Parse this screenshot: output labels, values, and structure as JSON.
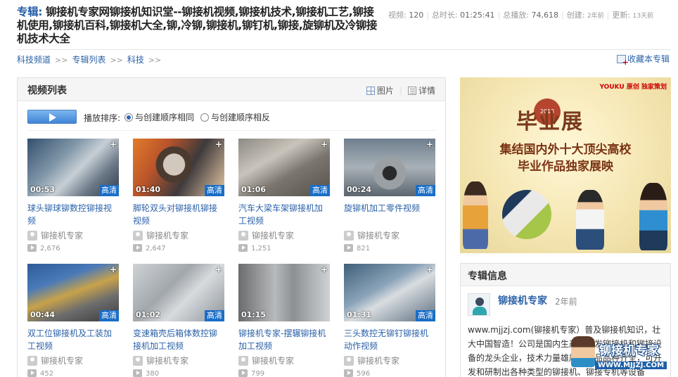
{
  "header": {
    "prefix": "专辑:",
    "title": "铆接机专家网铆接机知识堂--铆接机视频,铆接机技术,铆接机工艺,铆接机使用,铆接机百科,铆接机大全,铆,冷铆,铆接机,铆钉机,铆接,旋铆机及冷铆接机技术大全"
  },
  "stats": {
    "videos_label": "视频:",
    "videos": "120",
    "duration_label": "总时长:",
    "duration": "01:25:41",
    "plays_label": "总播放:",
    "plays": "74,618",
    "created_label": "创建:",
    "created": "2年前",
    "updated_label": "更新:",
    "updated": "13天前"
  },
  "breadcrumb": {
    "items": [
      "科技频道",
      "专辑列表",
      "科技"
    ],
    "sep": ">>"
  },
  "favorite": {
    "label": "收藏本专辑"
  },
  "panel": {
    "title": "视频列表",
    "view_grid": "图片",
    "view_list": "详情",
    "sort_label": "播放排序:",
    "sort_same": "与创建顺序相同",
    "sort_reverse": "与创建顺序相反"
  },
  "videos": [
    {
      "title": "球头铆球铆数控铆接视频",
      "duration": "00:53",
      "badge": "高清",
      "author": "铆接机专家",
      "views": "2,676"
    },
    {
      "title": "脚轮双头对铆接机铆接视频",
      "duration": "01:40",
      "badge": "高清",
      "author": "铆接机专家",
      "views": "2,647"
    },
    {
      "title": "汽车大梁车架铆接机加工视频",
      "duration": "01:06",
      "badge": "高清",
      "author": "铆接机专家",
      "views": "1,251"
    },
    {
      "title": "旋铆机加工零件视频",
      "duration": "00:24",
      "badge": "高清",
      "author": "铆接机专家",
      "views": "821"
    },
    {
      "title": "双工位铆接机及工装加工视频",
      "duration": "00:44",
      "badge": "高清",
      "author": "铆接机专家",
      "views": "452"
    },
    {
      "title": "变速箱壳后箱体数控铆接机加工视频",
      "duration": "01:02",
      "badge": "高清",
      "author": "铆接机专家",
      "views": "380"
    },
    {
      "title": "铆接机专家-摆辗铆接机加工视频",
      "duration": "01:15",
      "badge": "",
      "author": "铆接机专家",
      "views": "799"
    },
    {
      "title": "三头数控无铆钉铆接机动作视频",
      "duration": "01:31",
      "badge": "高清",
      "author": "铆接机专家",
      "views": "596"
    }
  ],
  "banner": {
    "brand": "YOUKU 原创 独家策划",
    "year": "2013",
    "headline": "毕业展",
    "line1": "集结国内外十大顶尖高校",
    "line2": "毕业作品独家展映"
  },
  "album_info": {
    "title": "专辑信息",
    "author": "铆接机专家",
    "time": "2年前",
    "description": "www.mjjzj.com(铆接机专家）普及铆接机知识，壮大中国智造！公司是国内生产、研发铆接机和铆接设备的龙头企业，技术力量雄厚，产品品种齐全，可开发和研制出各种类型的铆接机、铆接专机等设备"
  },
  "watermark": {
    "name": "铆接机专家",
    "url": "WWW.MJJZJ.COM"
  }
}
